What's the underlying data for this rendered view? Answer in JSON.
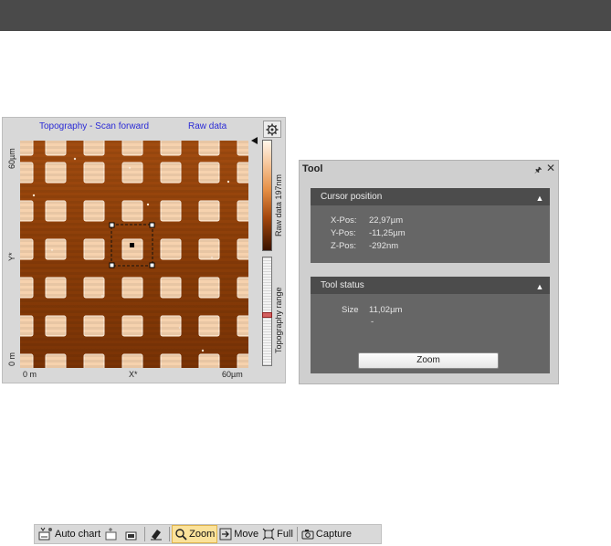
{
  "chart_panel": {
    "title_left": "Topography - Scan forward",
    "title_right": "Raw data",
    "y_top": "60µm",
    "y_bottom": "0 m",
    "y_axis": "Y*",
    "x_left": "0 m",
    "x_mid": "X*",
    "x_right": "60µm",
    "colorbar_label": "Raw data 197nm",
    "range_label": "Topography range",
    "settings_icon": "gear-icon"
  },
  "tool": {
    "title": "Tool",
    "cursor": {
      "heading": "Cursor position",
      "xpos_label": "X-Pos:",
      "xpos_value": "22,97µm",
      "ypos_label": "Y-Pos:",
      "ypos_value": "-11,25µm",
      "zpos_label": "Z-Pos:",
      "zpos_value": "-292nm"
    },
    "status": {
      "heading": "Tool status",
      "size_label": "Size",
      "size_value": "11,02µm",
      "dash": "-",
      "zoom_button": "Zoom"
    }
  },
  "toolbar": {
    "auto_chart": "Auto chart",
    "zoom": "Zoom",
    "move": "Move",
    "full": "Full",
    "capture": "Capture"
  },
  "colors": {
    "topbar": "#4a4a4a",
    "title_text": "#2b2bd6",
    "section_head": "#4c4c4c",
    "section_body": "#666666",
    "toolbar_active": "#fbe29a"
  }
}
